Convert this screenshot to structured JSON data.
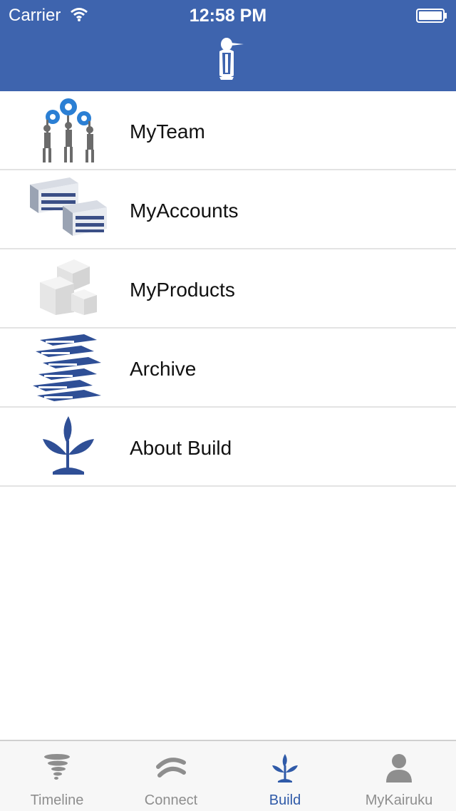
{
  "status_bar": {
    "carrier": "Carrier",
    "time": "12:58 PM"
  },
  "header": {
    "logo_icon": "penguin-logo-icon"
  },
  "menu": {
    "items": [
      {
        "label": "MyTeam",
        "icon": "team-gears-icon"
      },
      {
        "label": "MyAccounts",
        "icon": "buildings-icon"
      },
      {
        "label": "MyProducts",
        "icon": "boxes-icon"
      },
      {
        "label": "Archive",
        "icon": "binders-icon"
      },
      {
        "label": "About Build",
        "icon": "sprout-icon"
      }
    ]
  },
  "tab_bar": {
    "tabs": [
      {
        "label": "Timeline",
        "icon": "tornado-icon"
      },
      {
        "label": "Connect",
        "icon": "connect-icon"
      },
      {
        "label": "Build",
        "icon": "sprout-icon"
      },
      {
        "label": "MyKairuku",
        "icon": "person-icon"
      }
    ],
    "active_index": 2
  },
  "colors": {
    "header_bg": "#3e64ae",
    "accent": "#2f5aa8",
    "tab_inactive": "#8e8e8e"
  }
}
